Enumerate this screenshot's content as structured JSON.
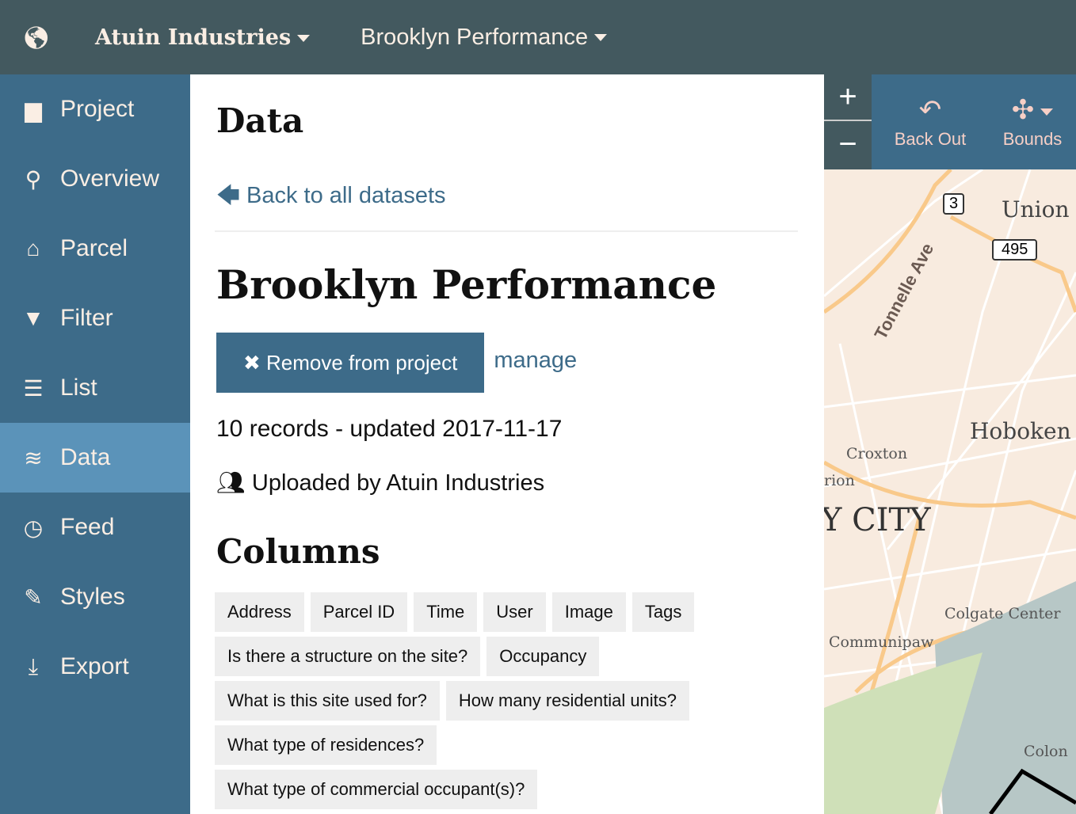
{
  "topbar": {
    "icon": "globe-icon",
    "org": "Atuin Industries",
    "project": "Brooklyn Performance"
  },
  "sidebar": {
    "items": [
      {
        "label": "Project",
        "icon": "folder-icon",
        "glyph": "▆"
      },
      {
        "label": "Overview",
        "icon": "map-marker-icon",
        "glyph": "⚲"
      },
      {
        "label": "Parcel",
        "icon": "home-icon",
        "glyph": "⌂"
      },
      {
        "label": "Filter",
        "icon": "filter-icon",
        "glyph": "▼"
      },
      {
        "label": "List",
        "icon": "list-icon",
        "glyph": "☰"
      },
      {
        "label": "Data",
        "icon": "database-icon",
        "glyph": "≋",
        "active": true
      },
      {
        "label": "Feed",
        "icon": "clock-icon",
        "glyph": "◷"
      },
      {
        "label": "Styles",
        "icon": "brush-icon",
        "glyph": "✎"
      },
      {
        "label": "Export",
        "icon": "download-icon",
        "glyph": "⤓"
      }
    ]
  },
  "main": {
    "title": "Data",
    "back_link": "Back to all datasets",
    "dataset_title": "Brooklyn Performance",
    "remove_button": "Remove from project",
    "manage_link": "manage",
    "records": "10 records - updated 2017-11-17",
    "uploaded": "Uploaded by Atuin Industries",
    "columns_title": "Columns",
    "columns": [
      "Address",
      "Parcel ID",
      "Time",
      "User",
      "Image",
      "Tags",
      "Is there a structure on the site?",
      "Occupancy",
      "What is this site used for?",
      "How many residential units?",
      "What type of residences?",
      "What type of commercial occupant(s)?"
    ]
  },
  "map": {
    "zoom_in": "+",
    "zoom_out": "−",
    "back_out": "Back Out",
    "bounds": "Bounds",
    "labels": [
      "Union",
      "Tonnelle Ave",
      "Hoboken",
      "Croxton",
      "rion",
      "Y CITY",
      "Colgate Center",
      "Communipaw",
      "Colon"
    ],
    "shields": [
      "3",
      "495"
    ]
  }
}
